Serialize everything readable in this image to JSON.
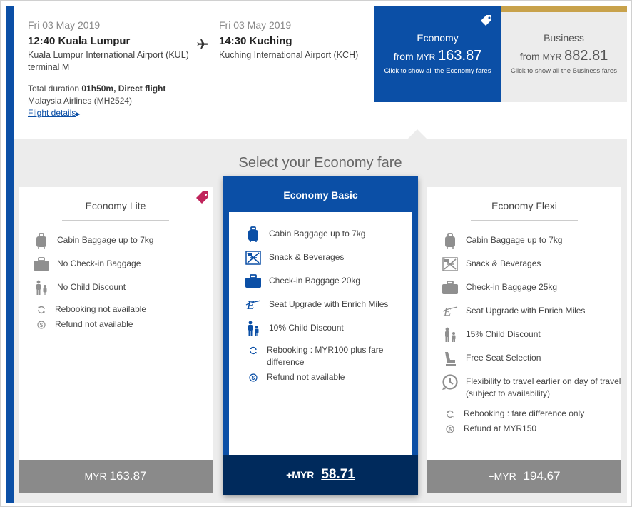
{
  "flight": {
    "departure": {
      "date": "Fri 03 May 2019",
      "time": "12:40",
      "city": "Kuala Lumpur",
      "airport": "Kuala Lumpur International Airport (KUL)",
      "terminal": "terminal M"
    },
    "arrival": {
      "date": "Fri 03 May 2019",
      "time": "14:30",
      "city": "Kuching",
      "airport": "Kuching International Airport (KCH)"
    },
    "duration_prefix": "Total duration ",
    "duration": "01h50m, Direct flight",
    "carrier": "Malaysia Airlines (MH2524)",
    "details_link": "Flight details"
  },
  "cabins": {
    "economy": {
      "title": "Economy",
      "from": "from",
      "currency": "MYR",
      "amount": "163.87",
      "note": "Click to show all the Economy fares"
    },
    "business": {
      "title": "Business",
      "from": "from",
      "currency": "MYR",
      "amount": "882.81",
      "note": "Click to show all the Business fares"
    }
  },
  "heading": "Select your Economy fare",
  "fares": {
    "lite": {
      "title": "Economy Lite",
      "features": [
        {
          "icon": "cabin-bag-icon",
          "text": "Cabin Baggage up to 7kg"
        },
        {
          "icon": "checkin-bag-icon",
          "text": "No Check-in Baggage"
        },
        {
          "icon": "child-icon",
          "text": "No Child Discount"
        },
        {
          "icon": "rebook-icon",
          "text": "Rebooking not available"
        },
        {
          "icon": "refund-icon",
          "text": "Refund not available"
        }
      ],
      "price_currency": "MYR",
      "price_amount": "163.87"
    },
    "basic": {
      "title": "Economy Basic",
      "features": [
        {
          "icon": "cabin-bag-icon",
          "text": "Cabin Baggage up to 7kg"
        },
        {
          "icon": "meal-icon",
          "text": "Snack & Beverages"
        },
        {
          "icon": "checkin-bag-icon",
          "text": "Check-in Baggage 20kg"
        },
        {
          "icon": "enrich-icon",
          "text": "Seat Upgrade with Enrich Miles"
        },
        {
          "icon": "child-icon",
          "text": "10% Child Discount"
        },
        {
          "icon": "rebook-icon",
          "text": "Rebooking : MYR100 plus fare difference"
        },
        {
          "icon": "refund-icon",
          "text": "Refund not available"
        }
      ],
      "price_prefix": "+MYR",
      "price_amount": "58.71"
    },
    "flexi": {
      "title": "Economy Flexi",
      "features": [
        {
          "icon": "cabin-bag-icon",
          "text": "Cabin Baggage up to 7kg"
        },
        {
          "icon": "meal-icon",
          "text": "Snack & Beverages"
        },
        {
          "icon": "checkin-bag-icon",
          "text": "Check-in Baggage 25kg"
        },
        {
          "icon": "enrich-icon",
          "text": "Seat Upgrade with Enrich Miles"
        },
        {
          "icon": "child-icon",
          "text": "15% Child Discount"
        },
        {
          "icon": "seat-icon",
          "text": "Free Seat Selection"
        },
        {
          "icon": "clock-icon",
          "text": "Flexibility to travel earlier on day of travel (subject to availability)"
        },
        {
          "icon": "rebook-icon",
          "text": "Rebooking : fare difference only"
        },
        {
          "icon": "refund-icon",
          "text": "Refund at MYR150"
        }
      ],
      "price_prefix": "+MYR",
      "price_amount": "194.67"
    }
  },
  "colors": {
    "brand_blue": "#0b4fa6",
    "navy": "#002a5c",
    "gold": "#c8a24b",
    "promo_tag": "#c0245b",
    "panel_grey": "#ececec",
    "price_grey": "#8a8a8a"
  }
}
